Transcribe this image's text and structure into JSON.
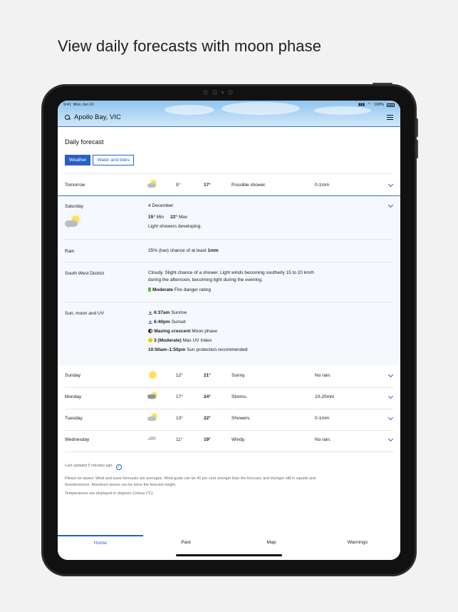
{
  "headline": "View daily forecasts with moon phase",
  "status_bar": {
    "time": "9:41",
    "date": "Mon Jun 10",
    "battery": "100%"
  },
  "header": {
    "location": "Apollo Bay, VIC"
  },
  "page": {
    "title": "Daily forecast"
  },
  "tabs": [
    {
      "label": "Weather",
      "active": true
    },
    {
      "label": "Water and tides",
      "active": false
    }
  ],
  "tomorrow": {
    "day": "Tomorrow",
    "icon": "showers-icon",
    "min": "9°",
    "max": "17°",
    "desc": "Possible shower.",
    "rain": "0-1mm"
  },
  "saturday": {
    "day": "Saturday",
    "date": "4 December",
    "min": "15°",
    "min_label": "Min",
    "max": "22°",
    "max_label": "Max",
    "summary": "Light showers developing.",
    "rain_label": "Rain",
    "rain_text": "25% (low) chance of at least",
    "rain_amount": "1mm",
    "district_label": "South West District",
    "district_text_1": "Cloudy. Slight chance of a shower. Light winds becoming southerly 15 to 20 km/h",
    "district_text_2": "during the afternoon, becoming light during the evening.",
    "fire_level": "Moderate",
    "fire_label": "Fire danger rating",
    "smu_label": "Sun, moon and UV",
    "sunrise_time": "6:37am",
    "sunrise_label": "Sunrise",
    "sunset_time": "6:40pm",
    "sunset_label": "Sunset",
    "moon_phase": "Waxing crescent",
    "moon_label": "Moon phase",
    "uv_value": "3 (Moderate)",
    "uv_label": "Max UV Index",
    "sun_protection_time": "10:50am–1:50pm",
    "sun_protection_label": "Sun protection recommended"
  },
  "days": [
    {
      "day": "Sunday",
      "icon": "sun-icon",
      "min": "12°",
      "max": "21°",
      "desc": "Sunny.",
      "rain": "No rain."
    },
    {
      "day": "Monday",
      "icon": "storm-icon",
      "min": "17°",
      "max": "24°",
      "desc": "Storms.",
      "rain": "10-20mm"
    },
    {
      "day": "Tuesday",
      "icon": "showers-icon",
      "min": "13°",
      "max": "22°",
      "desc": "Showers.",
      "rain": "0-1mm"
    },
    {
      "day": "Wednesday",
      "icon": "wind-icon",
      "min": "11°",
      "max": "19°",
      "desc": "Windy.",
      "rain": "No rain."
    }
  ],
  "footer": {
    "updated": "Last updated 5 minutes ago",
    "disclaimer_1": "Please be aware: Wind and wave forecasts are averages. Wind gusts can be 40 per cent stronger than the forecast, and stronger still in squalls and",
    "disclaimer_2": "thunderstorms. Maximum waves can be twice the forecast height.",
    "units_note": "Temperatures are displayed in degrees Celsius (°C)."
  },
  "nav": [
    {
      "label": "Home",
      "active": true
    },
    {
      "label": "Past"
    },
    {
      "label": "Map"
    },
    {
      "label": "Warnings"
    }
  ],
  "colors": {
    "accent": "#2a5fc9",
    "sky": "#a8d2f3"
  }
}
